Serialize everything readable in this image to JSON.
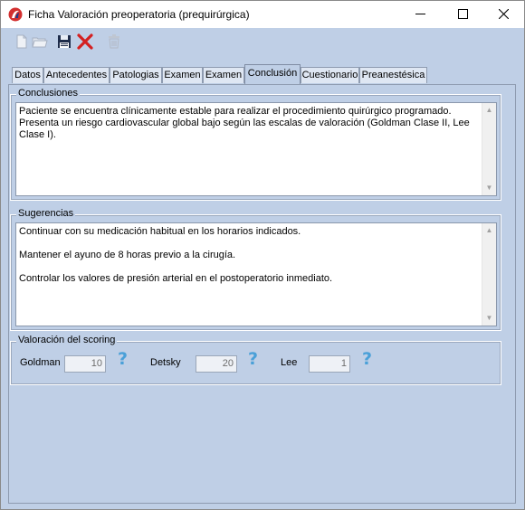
{
  "window": {
    "title": "Ficha Valoración preoperatoria (prequirúrgica)",
    "controls": {
      "minimize": "—",
      "maximize": "☐",
      "close": "✕"
    }
  },
  "toolbar": {
    "items": [
      "new-document-icon",
      "open-folder-icon",
      "save-icon",
      "delete-icon",
      "trash-icon"
    ]
  },
  "tabs": [
    {
      "label": "Datos"
    },
    {
      "label": "Antecedentes"
    },
    {
      "label": "Patologias"
    },
    {
      "label": "Examen"
    },
    {
      "label": "Examen"
    },
    {
      "label": "Conclusión",
      "active": true
    },
    {
      "label": "Cuestionario"
    },
    {
      "label": "Preanestésica"
    }
  ],
  "conclusiones": {
    "label": "Conclusiones",
    "text": "Paciente se encuentra clínicamente estable para realizar el procedimiento quirúrgico programado. Presenta un riesgo cardiovascular global bajo según las escalas de valoración (Goldman Clase II, Lee Clase I)."
  },
  "sugerencias": {
    "label": "Sugerencias",
    "text": "Continuar con su medicación habitual en los horarios indicados.\n\nMantener el ayuno de 8 horas previo a la cirugía.\n\nControlar los valores de presión arterial en el postoperatorio inmediato."
  },
  "scoring": {
    "label": "Valoración del scoring",
    "goldman": {
      "label": "Goldman",
      "value": "10"
    },
    "detsky": {
      "label": "Detsky",
      "value": "20"
    },
    "lee": {
      "label": "Lee",
      "value": "1"
    },
    "help": "?"
  },
  "colors": {
    "background": "#bfcfe6",
    "help_icon": "#4aa0d8",
    "delete_icon": "#d42020"
  }
}
